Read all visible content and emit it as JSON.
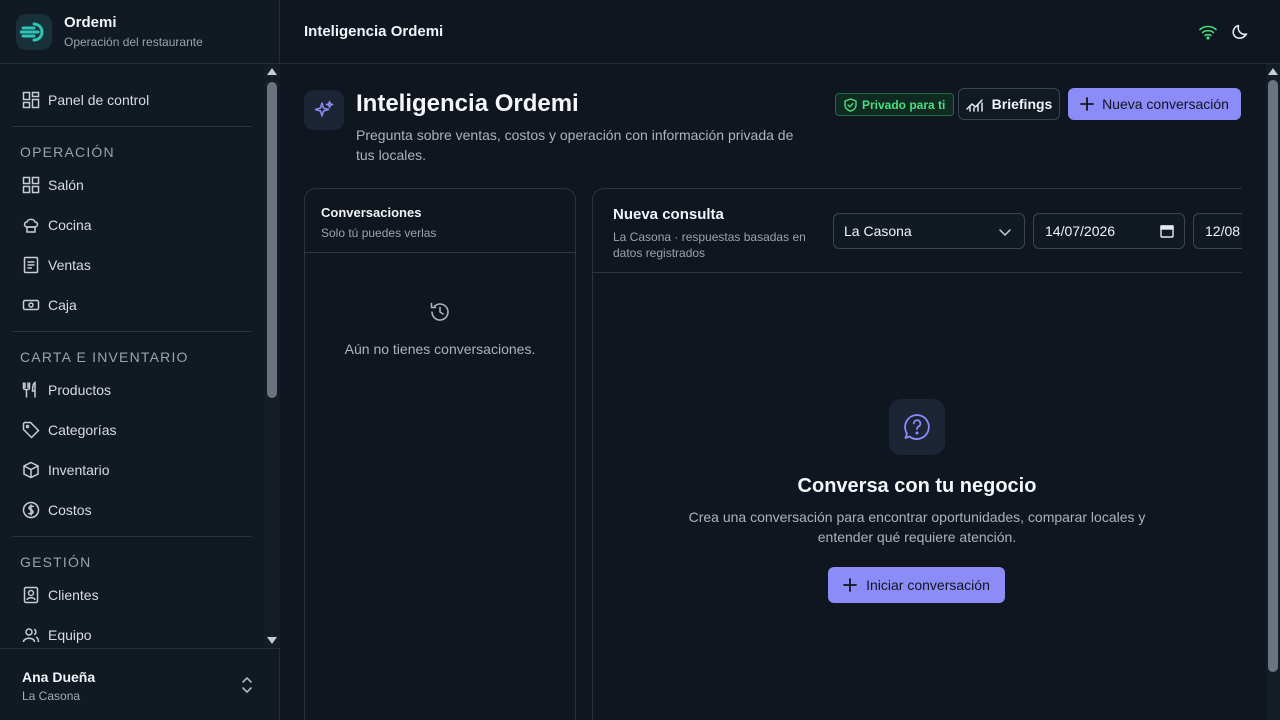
{
  "brand": {
    "name": "Ordemi",
    "subtitle": "Operación del restaurante",
    "icon": "ordemi-logo-icon"
  },
  "sidebar": {
    "top_item": {
      "label": "Panel de control",
      "icon": "dashboard-icon"
    },
    "sections": [
      {
        "title": "OPERACIÓN",
        "items": [
          {
            "label": "Salón",
            "icon": "grid-icon"
          },
          {
            "label": "Cocina",
            "icon": "chef-hat-icon"
          },
          {
            "label": "Ventas",
            "icon": "receipt-icon"
          },
          {
            "label": "Caja",
            "icon": "cash-icon"
          }
        ]
      },
      {
        "title": "CARTA E INVENTARIO",
        "items": [
          {
            "label": "Productos",
            "icon": "utensils-icon"
          },
          {
            "label": "Categorías",
            "icon": "tag-icon"
          },
          {
            "label": "Inventario",
            "icon": "package-icon"
          },
          {
            "label": "Costos",
            "icon": "dollar-circle-icon"
          }
        ]
      },
      {
        "title": "GESTIÓN",
        "items": [
          {
            "label": "Clientes",
            "icon": "contact-icon"
          },
          {
            "label": "Equipo",
            "icon": "users-icon"
          }
        ]
      }
    ],
    "user": {
      "name": "Ana Dueña",
      "place": "La Casona"
    }
  },
  "topbar": {
    "title": "Inteligencia Ordemi",
    "icons": [
      "wifi-icon",
      "moon-icon"
    ]
  },
  "header": {
    "title": "Inteligencia Ordemi",
    "description": "Pregunta sobre ventas, costos y operación con información privada de tus locales.",
    "badge": "Privado para ti",
    "briefings_label": "Briefings",
    "new_label": "Nueva conversación"
  },
  "conversations": {
    "title": "Conversaciones",
    "subtitle": "Solo tú puedes verlas",
    "empty": "Aún no tienes conversaciones."
  },
  "chat": {
    "title": "Nueva consulta",
    "subtitle": "La Casona · respuestas basadas en datos registrados",
    "local_value": "La Casona",
    "date_from": "14/07/2026",
    "date_to": "12/08",
    "empty_title": "Conversa con tu negocio",
    "empty_desc": "Crea una conversación para encontrar oportunidades, comparar locales y entender qué requiere atención.",
    "start_label": "Iniciar conversación"
  },
  "colors": {
    "accent": "#8b8cf8",
    "success": "#4ade80",
    "brand": "#2ec4b6"
  }
}
